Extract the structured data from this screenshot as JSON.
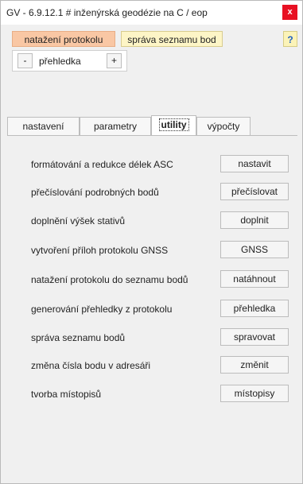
{
  "window": {
    "title": "GV - 6.9.12.1 # inženýrská geodézie na C / eop",
    "close_label": "x"
  },
  "toolbar": {
    "natazeni_label": "natažení protokolu",
    "sprava_label": "správa  seznamu bod",
    "help_label": "?",
    "zoom": {
      "minus_label": "-",
      "label": "přehledka",
      "plus_label": "+"
    }
  },
  "tabs": [
    {
      "label": "nastavení",
      "selected": false
    },
    {
      "label": "parametry",
      "selected": false
    },
    {
      "label": "utility",
      "selected": true
    },
    {
      "label": "výpočty",
      "selected": false
    }
  ],
  "utility_rows": [
    {
      "label": "formátování a redukce délek ASC",
      "button": "nastavit"
    },
    {
      "label": "přečíslování podrobných bodů",
      "button": "přečíslovat"
    },
    {
      "label": "doplnění výšek stativů",
      "button": "doplnit"
    },
    {
      "label": "vytvoření příloh protokolu GNSS",
      "button": "GNSS"
    },
    {
      "label": "natažení protokolu do seznamu bodů",
      "button": "natáhnout"
    },
    {
      "label": "generování přehledky z protokolu",
      "button": "přehledka"
    },
    {
      "label": "správa seznamu bodů",
      "button": "spravovat"
    },
    {
      "label": "změna čísla bodu v adresáři",
      "button": "změnit"
    },
    {
      "label": "tvorba místopisů",
      "button": "místopisy"
    }
  ],
  "colors": {
    "close": "#e81123",
    "natazeni_bg": "#f9c7a4",
    "sprava_bg": "#fdf5c6"
  }
}
